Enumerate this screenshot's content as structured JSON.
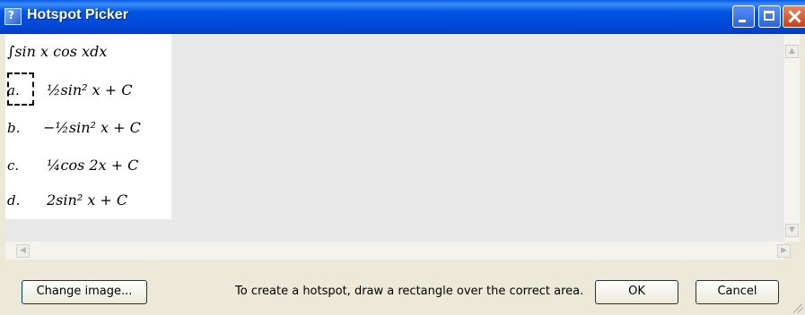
{
  "window": {
    "title": "Hotspot Picker"
  },
  "question": {
    "integral": "∫sin x cos xdx",
    "options": [
      {
        "label": "a.",
        "expression": "½sin² x + C"
      },
      {
        "label": "b.",
        "expression": "−½sin² x + C"
      },
      {
        "label": "c.",
        "expression": "¼cos 2x + C"
      },
      {
        "label": "d.",
        "expression": "2sin² x + C"
      }
    ]
  },
  "footer": {
    "change_image_label": "Change image...",
    "instruction": "To create a hotspot, draw a rectangle over the correct area.",
    "ok_label": "OK",
    "cancel_label": "Cancel"
  }
}
